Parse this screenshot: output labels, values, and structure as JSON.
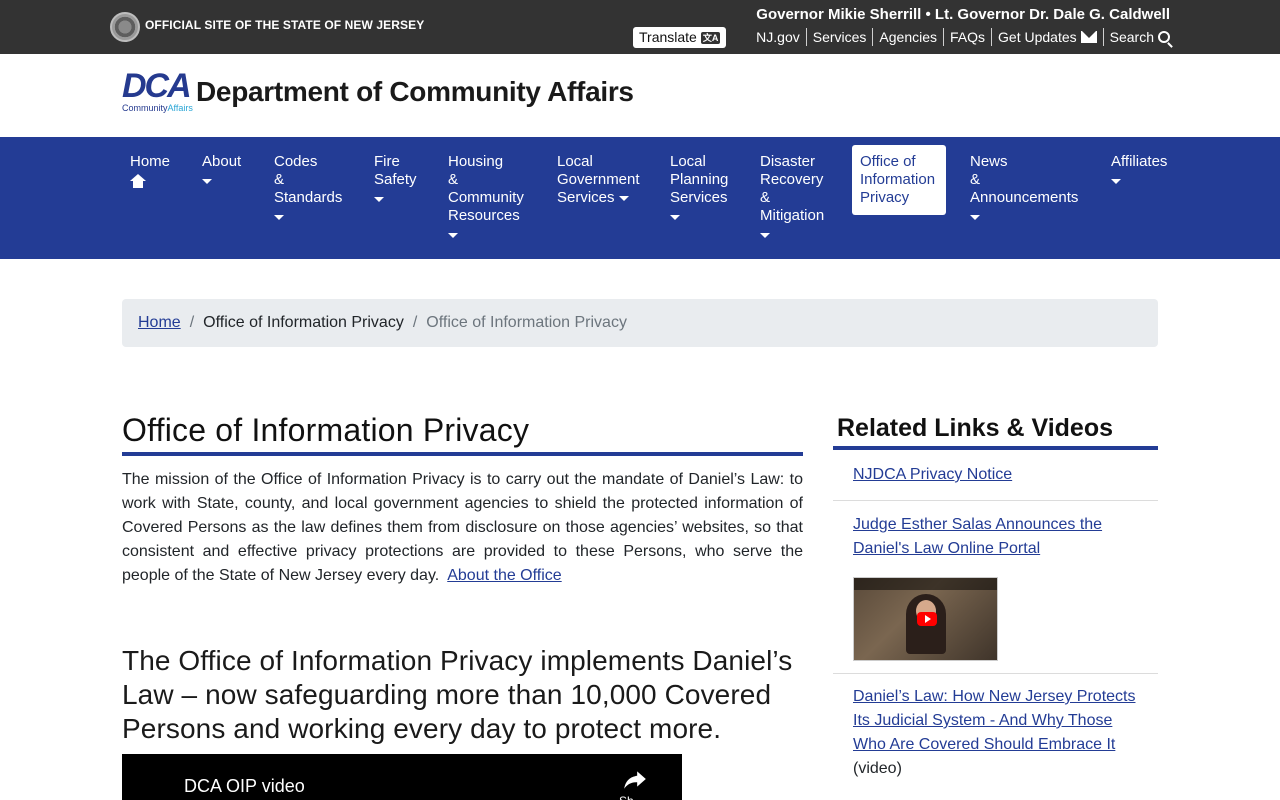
{
  "topbar": {
    "official": "OFFICIAL SITE OF THE STATE OF NEW JERSEY",
    "governor": "Governor Mikie Sherrill • Lt. Governor Dr. Dale G. Caldwell",
    "translate": "Translate",
    "translate_icon": "文A",
    "links": [
      "NJ.gov",
      "Services",
      "Agencies",
      "FAQs",
      "Get Updates",
      "Search"
    ]
  },
  "header": {
    "logo_text": "DCA",
    "logo_sub_a": "Community",
    "logo_sub_b": "Affairs",
    "title": "Department of Community Affairs"
  },
  "nav": {
    "items": [
      "Home",
      "About",
      "Codes\n&\nStandards",
      "Fire\nSafety",
      "Housing\n&\nCommunity\nResources",
      "Local\nGovernment\nServices",
      "Local\nPlanning\nServices",
      "Disaster\nRecovery\n&\nMitigation",
      "Office of\nInformation\nPrivacy",
      "News\n&\nAnnouncements",
      "Affiliates"
    ]
  },
  "breadcrumb": {
    "home": "Home",
    "middle": "Office of Information Privacy",
    "current": "Office of Information Privacy",
    "separator": "/"
  },
  "main": {
    "title": "Office of Information Privacy",
    "mission": "The mission of the Office of Information Privacy is to carry out the mandate of Daniel’s Law: to work with State, county, and local government agencies to shield the protected information of Covered Persons as the law defines them from disclosure on those agencies’ websites, so that consistent and effective privacy protections are provided to these Persons, who serve the people of the State of New Jersey every day.",
    "about_link": "About the Office",
    "subhead": "The Office of Information Privacy implements Daniel’s Law – now safeguarding more than 10,000 Covered Persons and working every day to protect more.",
    "video_title": "DCA OIP video",
    "share_label": "Sh"
  },
  "sidebar": {
    "title": "Related Links & Videos",
    "link1": "NJDCA Privacy Notice",
    "link2": "Judge Esther Salas Announces the Daniel's Law Online Portal",
    "link3": "Daniel’s Law: How New Jersey Protects Its Judicial System - And Why Those Who Are Covered Should Embrace It",
    "link3_suffix": "(video)"
  }
}
